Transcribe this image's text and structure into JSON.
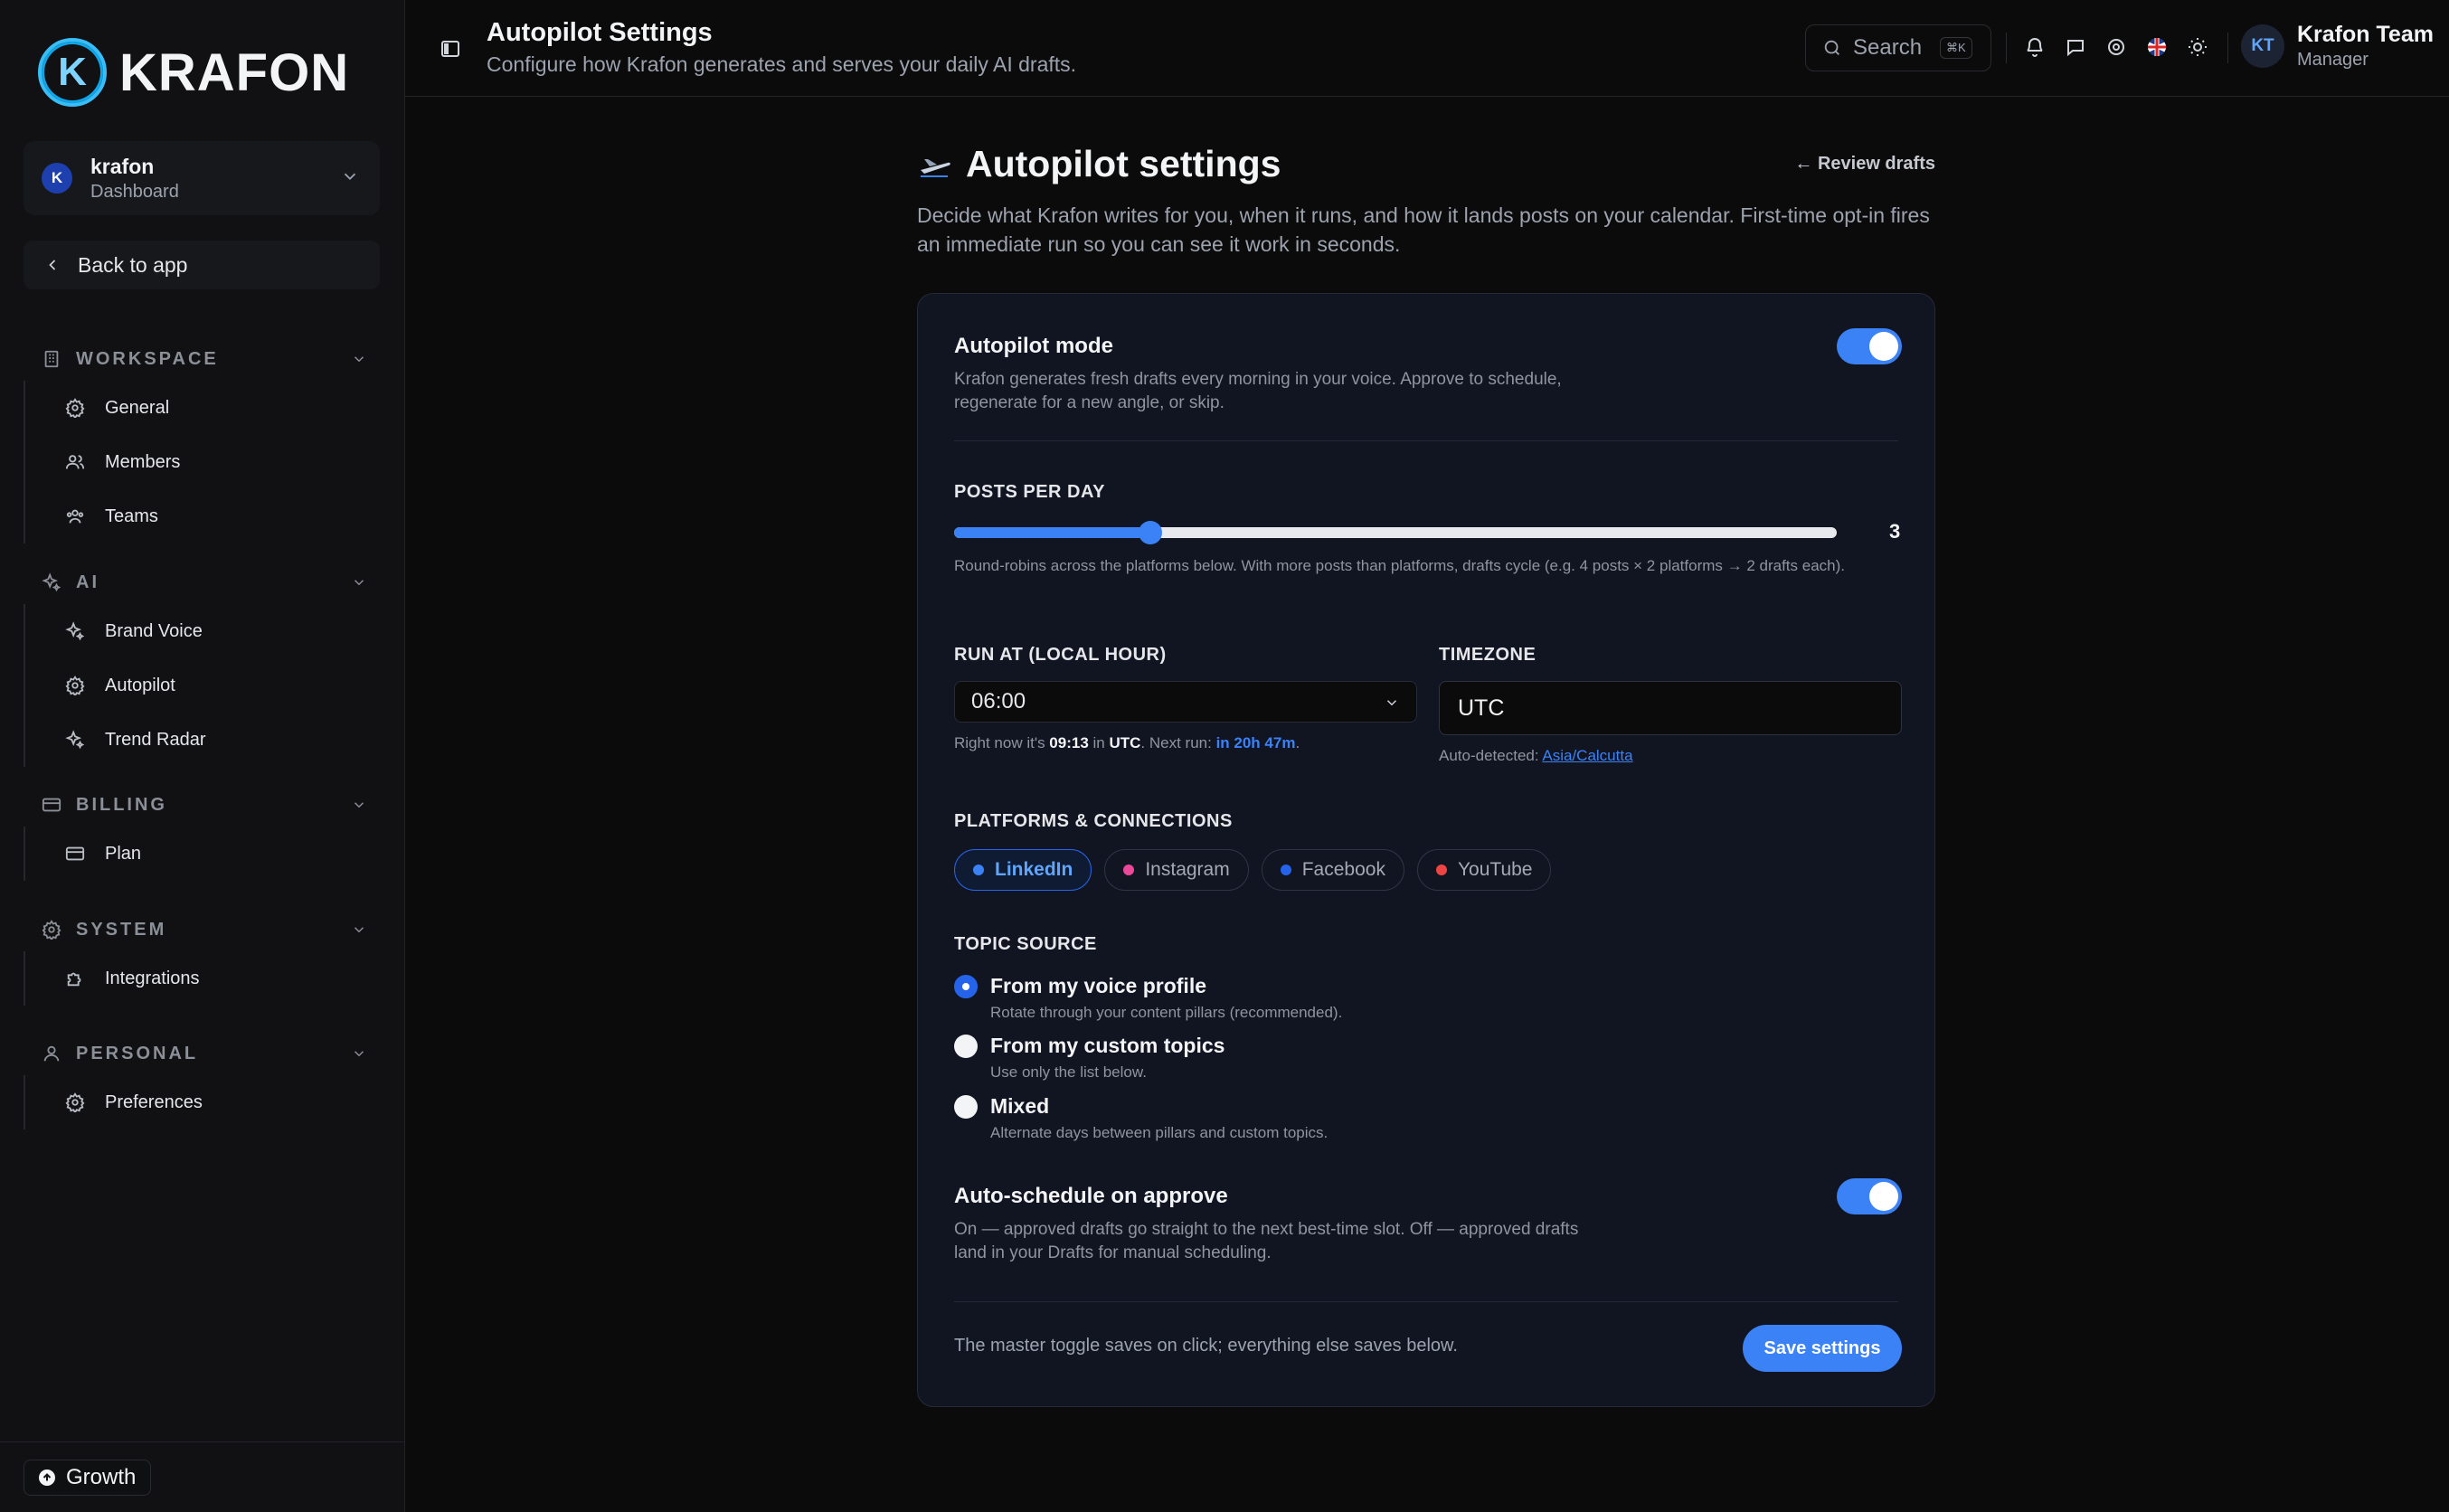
{
  "brand": {
    "name": "KRAFON",
    "mark": "K"
  },
  "workspace": {
    "avatar": "K",
    "name": "krafon",
    "sub": "Dashboard"
  },
  "back": {
    "label": "Back to app"
  },
  "sidebar": {
    "sections": [
      {
        "title": "WORKSPACE",
        "items": [
          "General",
          "Members",
          "Teams"
        ]
      },
      {
        "title": "AI",
        "items": [
          "Brand Voice",
          "Autopilot",
          "Trend Radar"
        ]
      },
      {
        "title": "BILLING",
        "items": [
          "Plan"
        ]
      },
      {
        "title": "SYSTEM",
        "items": [
          "Integrations"
        ]
      },
      {
        "title": "PERSONAL",
        "items": [
          "Preferences"
        ]
      }
    ],
    "plan_badge": "Growth"
  },
  "topbar": {
    "title": "Autopilot Settings",
    "subtitle": "Configure how Krafon generates and serves your daily AI drafts.",
    "search_label": "Search",
    "search_kbd": "⌘K",
    "user": {
      "initials": "KT",
      "name": "Krafon Team",
      "role": "Manager"
    }
  },
  "page": {
    "title": "Autopilot settings",
    "review_link": "← Review drafts",
    "intro": "Decide what Krafon writes for you, when it runs, and how it lands posts on your calendar. First-time opt-in fires an immediate run so you can see it work in seconds."
  },
  "autopilot": {
    "title": "Autopilot mode",
    "desc": "Krafon generates fresh drafts every morning in your voice. Approve to schedule, regenerate for a new angle, or skip.",
    "enabled": true
  },
  "posts_per_day": {
    "label": "POSTS PER DAY",
    "value": "3",
    "level": 0.2222,
    "help": "Round-robins across the platforms below. With more posts than platforms, drafts cycle (e.g. 4 posts × 2 platforms → 2 drafts each)."
  },
  "run_at": {
    "label": "RUN AT (LOCAL HOUR)",
    "value": "06:00",
    "now_prefix": "Right now it's ",
    "now_time": "09:13",
    "now_in": " in ",
    "now_tz": "UTC",
    "next_prefix": ". Next run: ",
    "next_run": "in 20h 47m",
    "suffix": "."
  },
  "timezone": {
    "label": "TIMEZONE",
    "value": "UTC",
    "auto_prefix": "Auto-detected: ",
    "auto_value": "Asia/Calcutta"
  },
  "platforms": {
    "label": "PLATFORMS & CONNECTIONS",
    "items": [
      {
        "name": "LinkedIn",
        "color": "#3b82f6",
        "active": true
      },
      {
        "name": "Instagram",
        "color": "#ec4899",
        "active": false
      },
      {
        "name": "Facebook",
        "color": "#2563eb",
        "active": false
      },
      {
        "name": "YouTube",
        "color": "#ef4444",
        "active": false
      }
    ]
  },
  "topic_source": {
    "label": "TOPIC SOURCE",
    "options": [
      {
        "title": "From my voice profile",
        "desc": "Rotate through your content pillars (recommended).",
        "selected": true
      },
      {
        "title": "From my custom topics",
        "desc": "Use only the list below.",
        "selected": false
      },
      {
        "title": "Mixed",
        "desc": "Alternate days between pillars and custom topics.",
        "selected": false
      }
    ]
  },
  "auto_schedule": {
    "title": "Auto-schedule on approve",
    "desc": "On — approved drafts go straight to the next best-time slot. Off — approved drafts land in your Drafts for manual scheduling.",
    "enabled": true
  },
  "footer": {
    "note": "The master toggle saves on click; everything else saves below.",
    "save_label": "Save settings"
  }
}
